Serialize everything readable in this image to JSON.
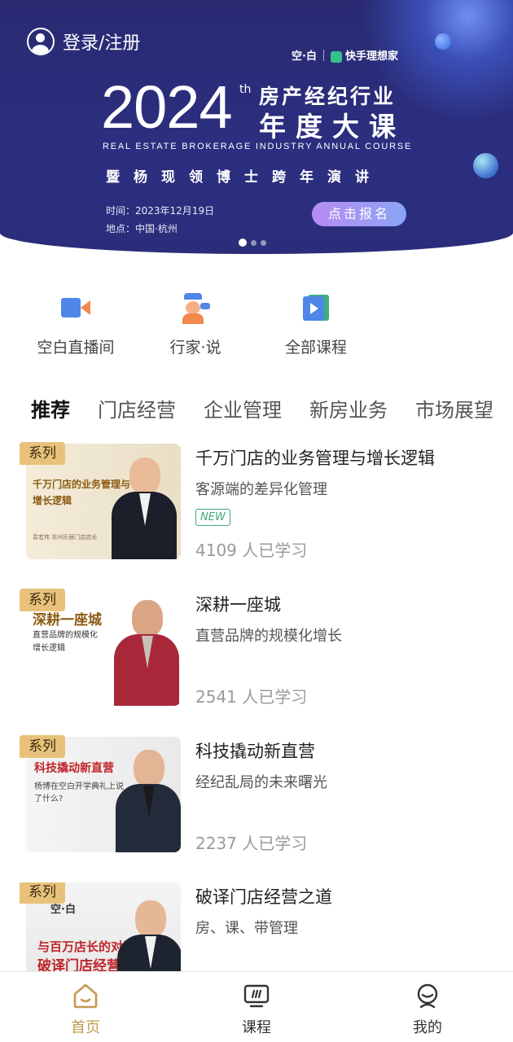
{
  "banner": {
    "login_text": "登录/注册",
    "logo_left": "空·白",
    "logo_right": "快手理想家",
    "year": "2024",
    "year_suffix": "th",
    "title_line1": "房产经纪行业",
    "title_line2": "年度大课",
    "english_title": "REAL ESTATE BROKERAGE INDUSTRY ANNUAL COURSE",
    "subtitle": "暨杨现领博士跨年演讲",
    "time": "时间：2023年12月19日",
    "place": "地点：中国·杭州",
    "signup_label": "点击报名",
    "carousel": {
      "count": 3,
      "active": 1
    }
  },
  "quick_entries": [
    {
      "label": "空白直播间",
      "icon": "video-camera-icon"
    },
    {
      "label": "行家·说",
      "icon": "expert-talk-icon"
    },
    {
      "label": "全部课程",
      "icon": "all-courses-icon"
    }
  ],
  "tabs": [
    "推荐",
    "门店经营",
    "企业管理",
    "新房业务",
    "市场展望"
  ],
  "active_tab": "推荐",
  "courses": [
    {
      "badge": "系列",
      "title": "千万门店的业务管理与增长逻辑",
      "subtitle": "客源端的差异化管理",
      "tag": "NEW",
      "count": "4109 人已学习",
      "thumb_title": "千万门店的业务管理与增长逻辑",
      "thumb_caption": "袁宏伟  苏州乐居门店店长"
    },
    {
      "badge": "系列",
      "title": "深耕一座城",
      "subtitle": "直营品牌的规模化增长",
      "count": "2541 人已学习",
      "thumb_title": "深耕一座城",
      "thumb_caption": "直营品牌的规模化增长逻辑"
    },
    {
      "badge": "系列",
      "title": "科技撬动新直营",
      "subtitle": "经纪乱局的未来曙光",
      "count": "2237 人已学习",
      "thumb_title": "科技撬动新直营",
      "thumb_caption": "杨博在空白开学典礼上说了什么?"
    },
    {
      "badge": "系列",
      "title": "破译门店经营之道",
      "subtitle": "房、课、带管理",
      "thumb_title": "与百万店长的对话实录",
      "thumb_caption": "破译门店经营之道",
      "thumb_logo": "空·白"
    }
  ],
  "nav": [
    {
      "label": "首页",
      "icon": "home-icon",
      "active": true
    },
    {
      "label": "课程",
      "icon": "course-icon",
      "active": false
    },
    {
      "label": "我的",
      "icon": "profile-icon",
      "active": false
    }
  ],
  "colors": {
    "banner_bg": "#2a2d7a",
    "accent_gold": "#c49a4e",
    "badge_gold": "#e8c27b",
    "new_green": "#3bab72",
    "icon_blue": "#4f86e8",
    "icon_orange": "#f2884d"
  }
}
